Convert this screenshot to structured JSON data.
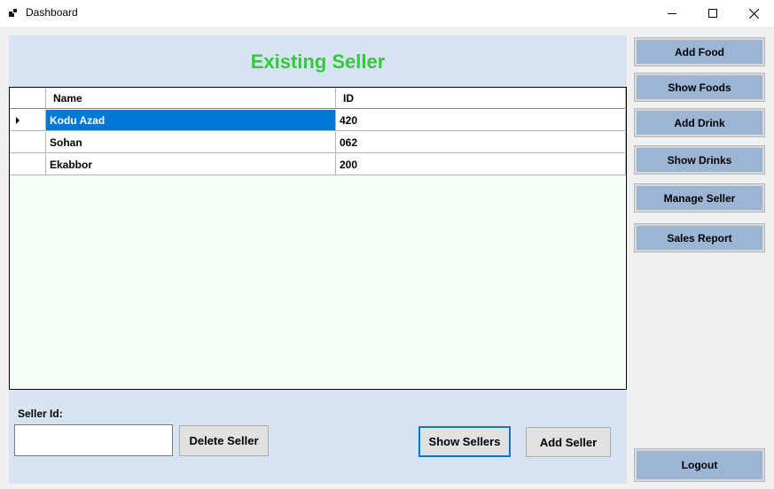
{
  "window": {
    "title": "Dashboard",
    "controls": [
      "minimize",
      "maximize",
      "close"
    ]
  },
  "header": {
    "title": "Existing Seller"
  },
  "table": {
    "columns": [
      "Name",
      "ID"
    ],
    "rows": [
      {
        "name": "Kodu Azad",
        "id": "420",
        "selected": true
      },
      {
        "name": "Sohan",
        "id": "062",
        "selected": false
      },
      {
        "name": "Ekabbor",
        "id": "200",
        "selected": false
      }
    ]
  },
  "form": {
    "seller_id_label": "Seller Id:",
    "seller_id_value": "",
    "delete_label": "Delete Seller",
    "show_label": "Show Sellers",
    "add_label": "Add Seller"
  },
  "sidebar": {
    "items": [
      {
        "label": "Add Food"
      },
      {
        "label": "Show Foods"
      },
      {
        "label": "Add Drink"
      },
      {
        "label": "Show Drinks"
      },
      {
        "label": "Manage Seller"
      },
      {
        "label": "Sales Report"
      }
    ],
    "logout_label": "Logout"
  },
  "colors": {
    "heading": "#33c93c",
    "panel": "#d6e3f0",
    "grid_background": "#f5fff8",
    "selection": "#0078d7",
    "sidebar_button": "#9db5d4"
  }
}
